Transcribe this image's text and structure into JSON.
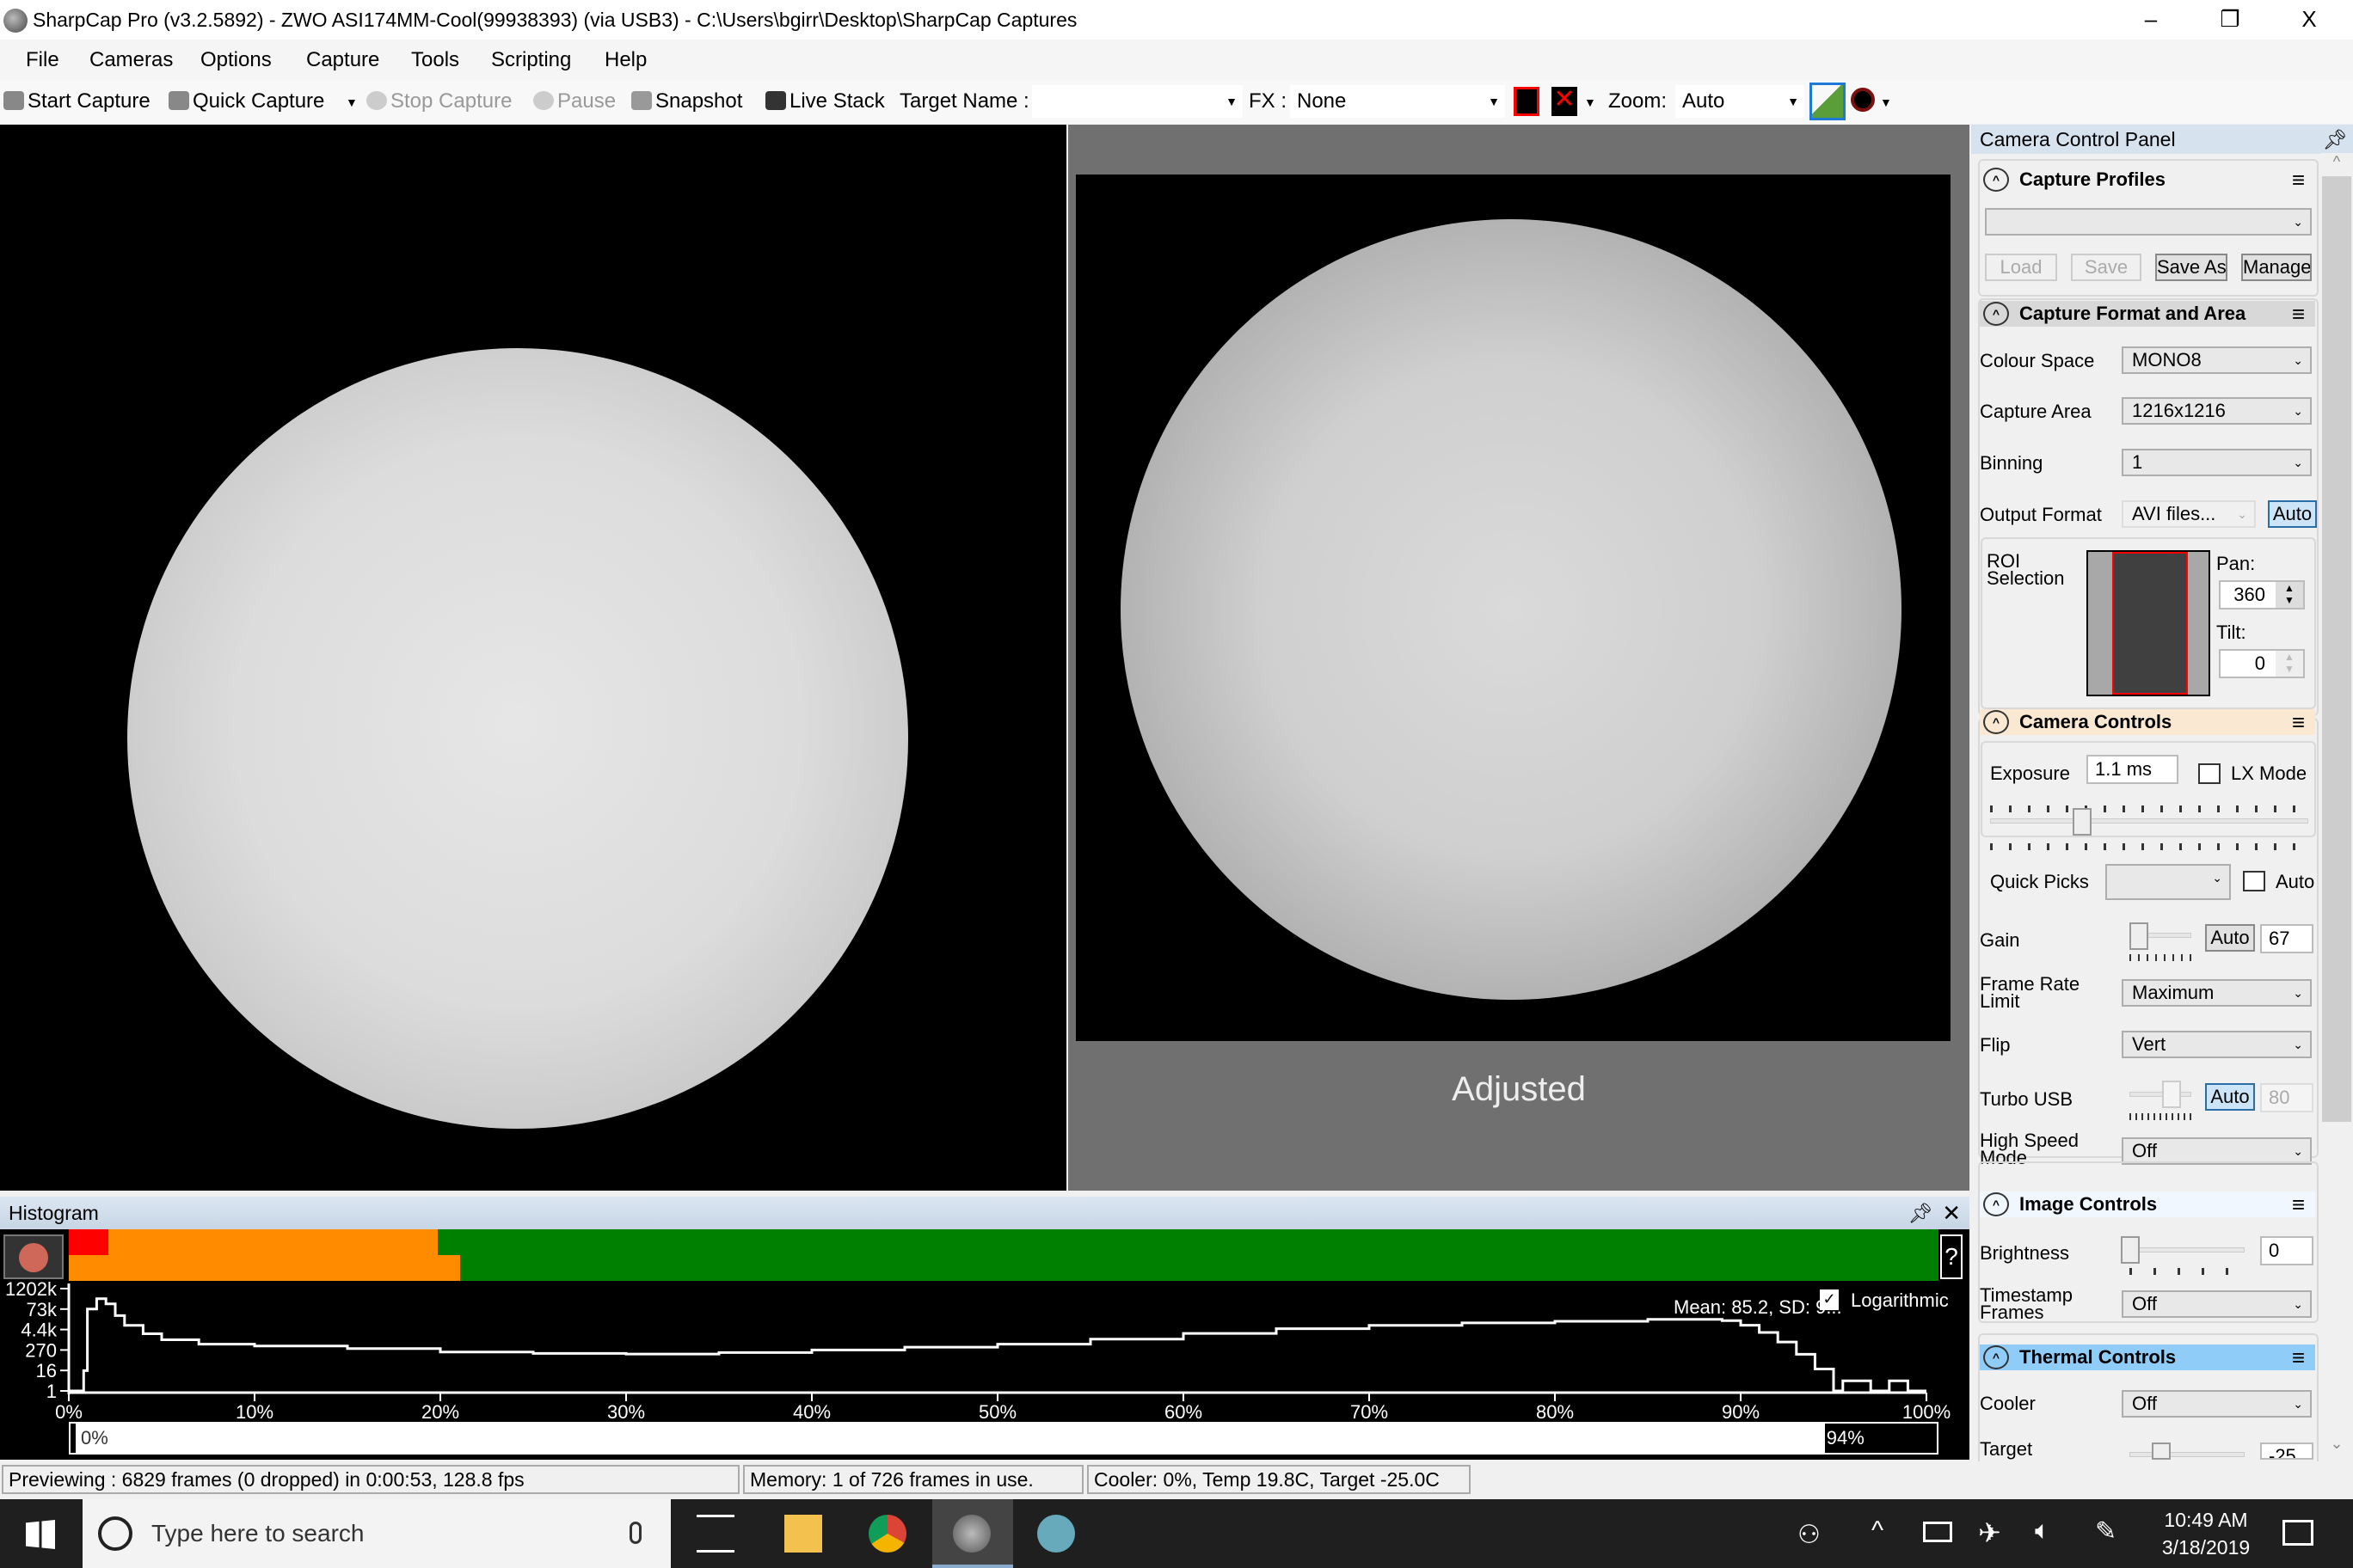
{
  "window": {
    "title": "SharpCap Pro (v3.2.5892) - ZWO ASI174MM-Cool(99938393) (via USB3) - C:\\Users\\bgirr\\Desktop\\SharpCap Captures",
    "minimize": "–",
    "maximize": "❐",
    "close": "X"
  },
  "menu": [
    "File",
    "Cameras",
    "Options",
    "Capture",
    "Tools",
    "Scripting",
    "Help"
  ],
  "toolbar": {
    "start_capture": "Start Capture",
    "quick_capture": "Quick Capture",
    "stop_capture": "Stop Capture",
    "pause": "Pause",
    "snapshot": "Snapshot",
    "live_stack": "Live Stack",
    "target_name_label": "Target Name :",
    "target_name_value": "",
    "fx_label": "FX :",
    "fx_value": "None",
    "zoom_label": "Zoom:",
    "zoom_value": "Auto"
  },
  "viewer": {
    "adjusted_label": "Adjusted"
  },
  "panel": {
    "title": "Camera Control Panel",
    "capture_profiles": {
      "title": "Capture Profiles",
      "profile_value": "",
      "load": "Load",
      "save": "Save",
      "save_as": "Save As",
      "manage": "Manage"
    },
    "capture_format": {
      "title": "Capture Format and Area",
      "colour_space_label": "Colour Space",
      "colour_space": "MONO8",
      "capture_area_label": "Capture Area",
      "capture_area": "1216x1216",
      "binning_label": "Binning",
      "binning": "1",
      "output_format_label": "Output Format",
      "output_format": "AVI files...",
      "auto": "Auto",
      "roi_label": "ROI Selection",
      "pan_label": "Pan:",
      "pan": "360",
      "tilt_label": "Tilt:",
      "tilt": "0"
    },
    "camera_controls": {
      "title": "Camera Controls",
      "exposure_label": "Exposure",
      "exposure": "1.1 ms",
      "lx_mode": "LX Mode",
      "lx_mode_checked": false,
      "quick_picks_label": "Quick Picks",
      "quick_picks": "",
      "auto": "Auto",
      "auto_checked": false,
      "gain_label": "Gain",
      "gain_auto": "Auto",
      "gain": "67",
      "frame_rate_label": "Frame Rate Limit",
      "frame_rate": "Maximum",
      "flip_label": "Flip",
      "flip": "Vert",
      "turbo_usb_label": "Turbo USB",
      "turbo_auto": "Auto",
      "turbo_usb": "80",
      "high_speed_label": "High Speed Mode",
      "high_speed": "Off"
    },
    "image_controls": {
      "title": "Image Controls",
      "brightness_label": "Brightness",
      "brightness": "0",
      "timestamp_label": "Timestamp Frames",
      "timestamp": "Off"
    },
    "thermal_controls": {
      "title": "Thermal Controls",
      "cooler_label": "Cooler",
      "cooler": "Off",
      "target_label": "Target",
      "target": "-25"
    }
  },
  "histogram": {
    "title": "Histogram",
    "help": "?",
    "logarithmic_label": "Logarithmic",
    "logarithmic": true,
    "stats": "Mean: 85.2, SD: 9...",
    "range_low": "0%",
    "range_high": "94%",
    "range_high_fraction": 0.94,
    "colors": {
      "red": "#ff0000",
      "orange": "#ff8c00",
      "green": "#008000"
    },
    "chart_data": {
      "type": "line",
      "yscale": "log",
      "x_ticks": [
        "0%",
        "10%",
        "20%",
        "30%",
        "40%",
        "50%",
        "60%",
        "70%",
        "80%",
        "90%",
        "100%"
      ],
      "y_ticks": [
        "1202k",
        "73k",
        "4.4k",
        "270",
        "16",
        "1"
      ],
      "x": [
        0,
        0.5,
        0.8,
        1,
        1.5,
        2,
        2.5,
        3,
        4,
        5,
        7,
        10,
        15,
        20,
        25,
        30,
        35,
        40,
        45,
        50,
        55,
        60,
        65,
        70,
        75,
        80,
        85,
        88,
        89,
        90,
        91,
        92,
        93,
        94,
        95,
        95.5,
        96,
        97,
        98,
        99,
        100
      ],
      "y": [
        1,
        1,
        16,
        73000,
        300000,
        150000,
        30000,
        7900,
        2500,
        1100,
        600,
        470,
        330,
        205,
        170,
        155,
        190,
        270,
        400,
        600,
        1200,
        2600,
        5000,
        7900,
        11000,
        13800,
        18000,
        18000,
        15000,
        8000,
        3000,
        800,
        150,
        20,
        1,
        4,
        4,
        1,
        4,
        1,
        1
      ]
    }
  },
  "status": {
    "previewing": "Previewing : 6829 frames (0 dropped) in 0:00:53, 128.8 fps",
    "memory": "Memory: 1 of 726 frames in use.",
    "cooler": "Cooler: 0%, Temp 19.8C, Target -25.0C"
  },
  "taskbar": {
    "search_placeholder": "Type here to search",
    "time": "10:49 AM",
    "date": "3/18/2019"
  }
}
